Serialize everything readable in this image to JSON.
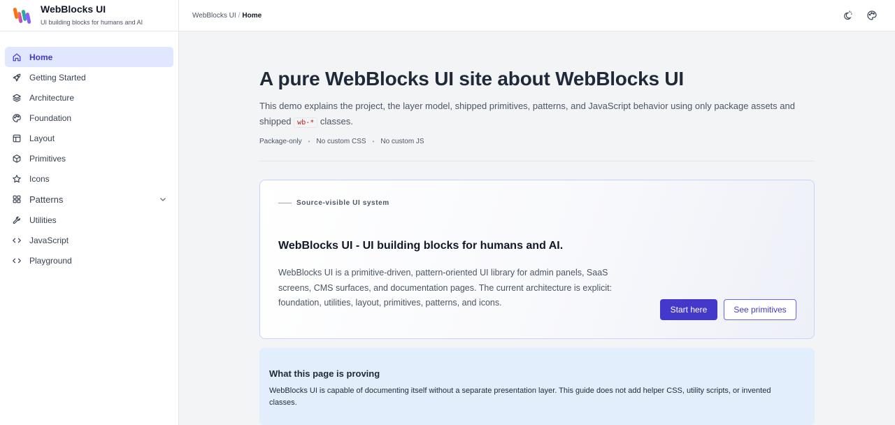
{
  "brand": {
    "name": "WebBlocks UI",
    "tagline": "UI building blocks for humans and AI"
  },
  "sidebar": {
    "items": [
      {
        "label": "Home",
        "icon": "home-icon",
        "active": true
      },
      {
        "label": "Getting Started",
        "icon": "rocket-icon"
      },
      {
        "label": "Architecture",
        "icon": "layers-icon"
      },
      {
        "label": "Foundation",
        "icon": "palette-icon"
      },
      {
        "label": "Layout",
        "icon": "layout-icon"
      },
      {
        "label": "Primitives",
        "icon": "cube-icon"
      },
      {
        "label": "Icons",
        "icon": "star-icon"
      },
      {
        "label": "Patterns",
        "icon": "grid-icon",
        "expandable": true
      },
      {
        "label": "Utilities",
        "icon": "wrench-icon"
      },
      {
        "label": "JavaScript",
        "icon": "code-icon"
      },
      {
        "label": "Playground",
        "icon": "code-icon"
      }
    ]
  },
  "breadcrumb": {
    "root": "WebBlocks UI",
    "separator": "/",
    "current": "Home"
  },
  "topbar": {
    "icons": [
      "theme-toggle-icon",
      "palette-icon"
    ]
  },
  "hero": {
    "title": "A pure WebBlocks UI site about WebBlocks UI",
    "lead_before": "This demo explains the project, the layer model, shipped primitives, patterns, and JavaScript behavior using only package assets and shipped",
    "lead_code": "wb-*",
    "lead_after": "classes.",
    "meta": [
      "Package-only",
      "No custom CSS",
      "No custom JS"
    ],
    "meta_separator": "•"
  },
  "card": {
    "eyebrow": "Source-visible UI system",
    "title": "WebBlocks UI - UI building blocks for humans and AI.",
    "body": "WebBlocks UI is a primitive-driven, pattern-oriented UI library for admin panels, SaaS screens, CMS surfaces, and documentation pages. The current architecture is explicit: foundation, utilities, layout, primitives, patterns, and icons.",
    "primary_label": "Start here",
    "secondary_label": "See primitives"
  },
  "callout": {
    "title": "What this page is proving",
    "body": "WebBlocks UI is capable of documenting itself without a separate presentation layer. This guide does not add helper CSS, utility scripts, or invented classes."
  },
  "colors": {
    "accent": "#4338ca",
    "active_bg": "#e0e7ff",
    "callout_bg": "#e2eefc",
    "code_text": "#b91c1c"
  }
}
